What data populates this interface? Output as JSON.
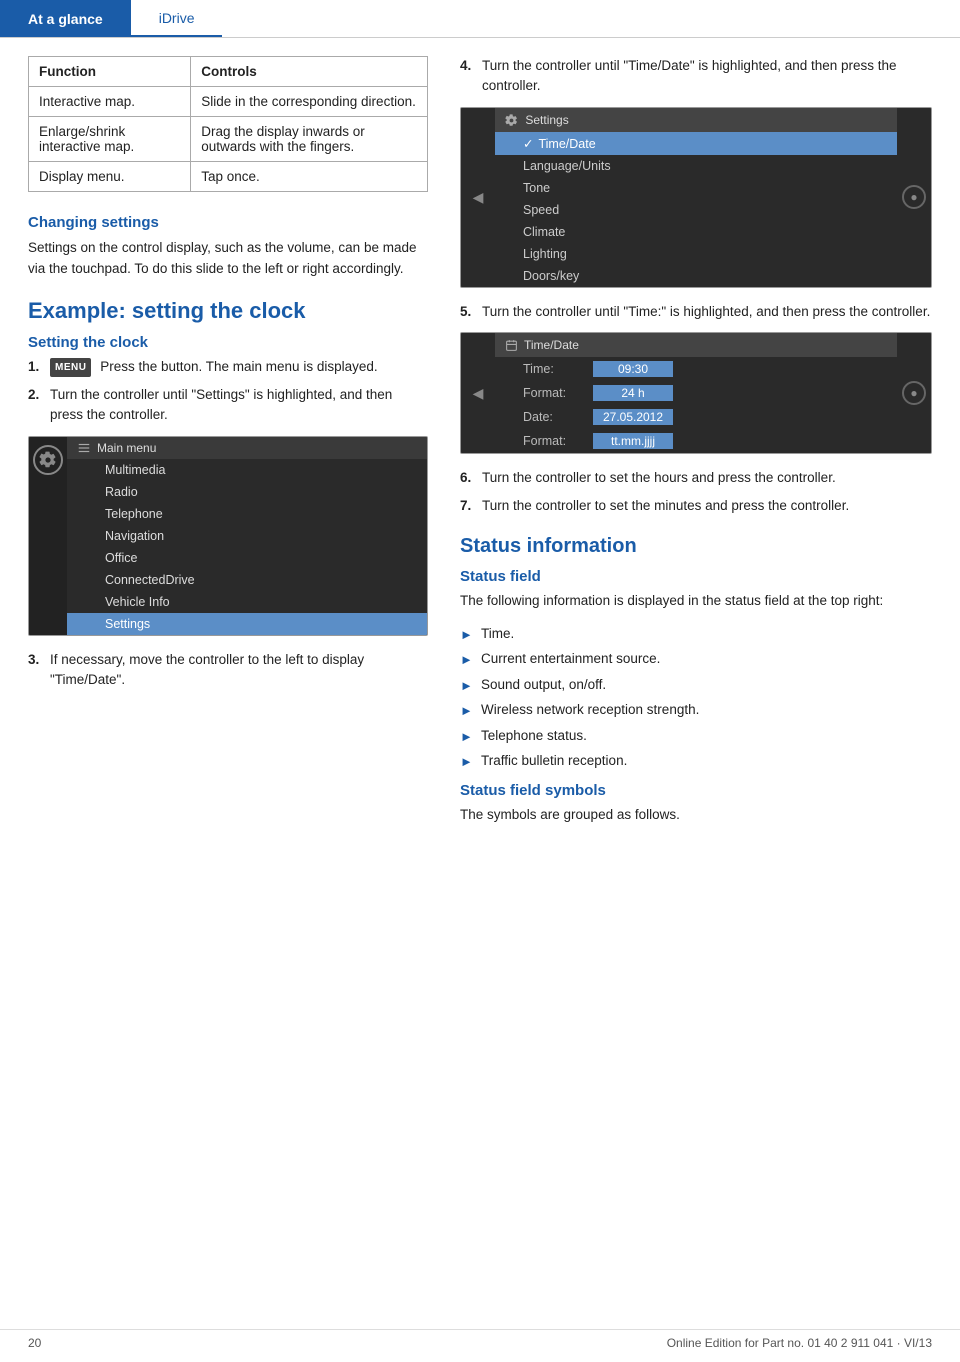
{
  "header": {
    "tab_active": "At a glance",
    "tab_inactive": "iDrive"
  },
  "table": {
    "col1_header": "Function",
    "col2_header": "Controls",
    "rows": [
      {
        "function": "Interactive map.",
        "controls": "Slide in the corresponding direction."
      },
      {
        "function": "Enlarge/shrink interactive map.",
        "controls": "Drag the display inwards or outwards with the fingers."
      },
      {
        "function": "Display menu.",
        "controls": "Tap once."
      }
    ]
  },
  "changing_settings": {
    "heading": "Changing settings",
    "body": "Settings on the control display, such as the volume, can be made via the touchpad. To do this slide to the left or right accordingly."
  },
  "example_section": {
    "big_heading": "Example: setting the clock",
    "setting_clock_heading": "Setting the clock"
  },
  "steps": [
    {
      "num": "1.",
      "menu_label": "MENU",
      "text": "Press the button. The main menu is displayed."
    },
    {
      "num": "2.",
      "text": "Turn the controller until \"Settings\" is highlighted, and then press the controller."
    },
    {
      "num": "3.",
      "text": "If necessary, move the controller to the left to display \"Time/Date\"."
    }
  ],
  "steps_right": [
    {
      "num": "4.",
      "text": "Turn the controller until \"Time/Date\" is highlighted, and then press the controller."
    },
    {
      "num": "5.",
      "text": "Turn the controller until \"Time:\" is highlighted, and then press the controller."
    },
    {
      "num": "6.",
      "text": "Turn the controller to set the hours and press the controller."
    },
    {
      "num": "7.",
      "text": "Turn the controller to set the minutes and press the controller."
    }
  ],
  "main_menu_screen": {
    "title": "Main menu",
    "items": [
      {
        "label": "Multimedia",
        "highlighted": false
      },
      {
        "label": "Radio",
        "highlighted": false
      },
      {
        "label": "Telephone",
        "highlighted": false
      },
      {
        "label": "Navigation",
        "highlighted": false
      },
      {
        "label": "Office",
        "highlighted": false
      },
      {
        "label": "ConnectedDrive",
        "highlighted": false
      },
      {
        "label": "Vehicle Info",
        "highlighted": false
      },
      {
        "label": "Settings",
        "highlighted": true
      }
    ]
  },
  "settings_screen": {
    "title": "Settings",
    "items": [
      {
        "label": "Time/Date",
        "highlighted": true
      },
      {
        "label": "Language/Units",
        "highlighted": false
      },
      {
        "label": "Tone",
        "highlighted": false
      },
      {
        "label": "Speed",
        "highlighted": false
      },
      {
        "label": "Climate",
        "highlighted": false
      },
      {
        "label": "Lighting",
        "highlighted": false
      },
      {
        "label": "Doors/key",
        "highlighted": false
      }
    ]
  },
  "timedate_screen": {
    "title": "Time/Date",
    "fields": [
      {
        "label": "Time:",
        "value": "09:30"
      },
      {
        "label": "Format:",
        "value": "24 h"
      },
      {
        "label": "Date:",
        "value": "27.05.2012"
      },
      {
        "label": "Format:",
        "value": "tt.mm.jjjj"
      }
    ]
  },
  "status_information": {
    "big_heading": "Status information",
    "status_field_heading": "Status field",
    "status_field_body": "The following information is displayed in the status field at the top right:",
    "bullet_items": [
      "Time.",
      "Current entertainment source.",
      "Sound output, on/off.",
      "Wireless network reception strength.",
      "Telephone status.",
      "Traffic bulletin reception."
    ],
    "status_field_symbols_heading": "Status field symbols",
    "status_field_symbols_body": "The symbols are grouped as follows."
  },
  "footer": {
    "page_number": "20",
    "copyright": "Online Edition for Part no. 01 40 2 911 041 · VI/13"
  }
}
